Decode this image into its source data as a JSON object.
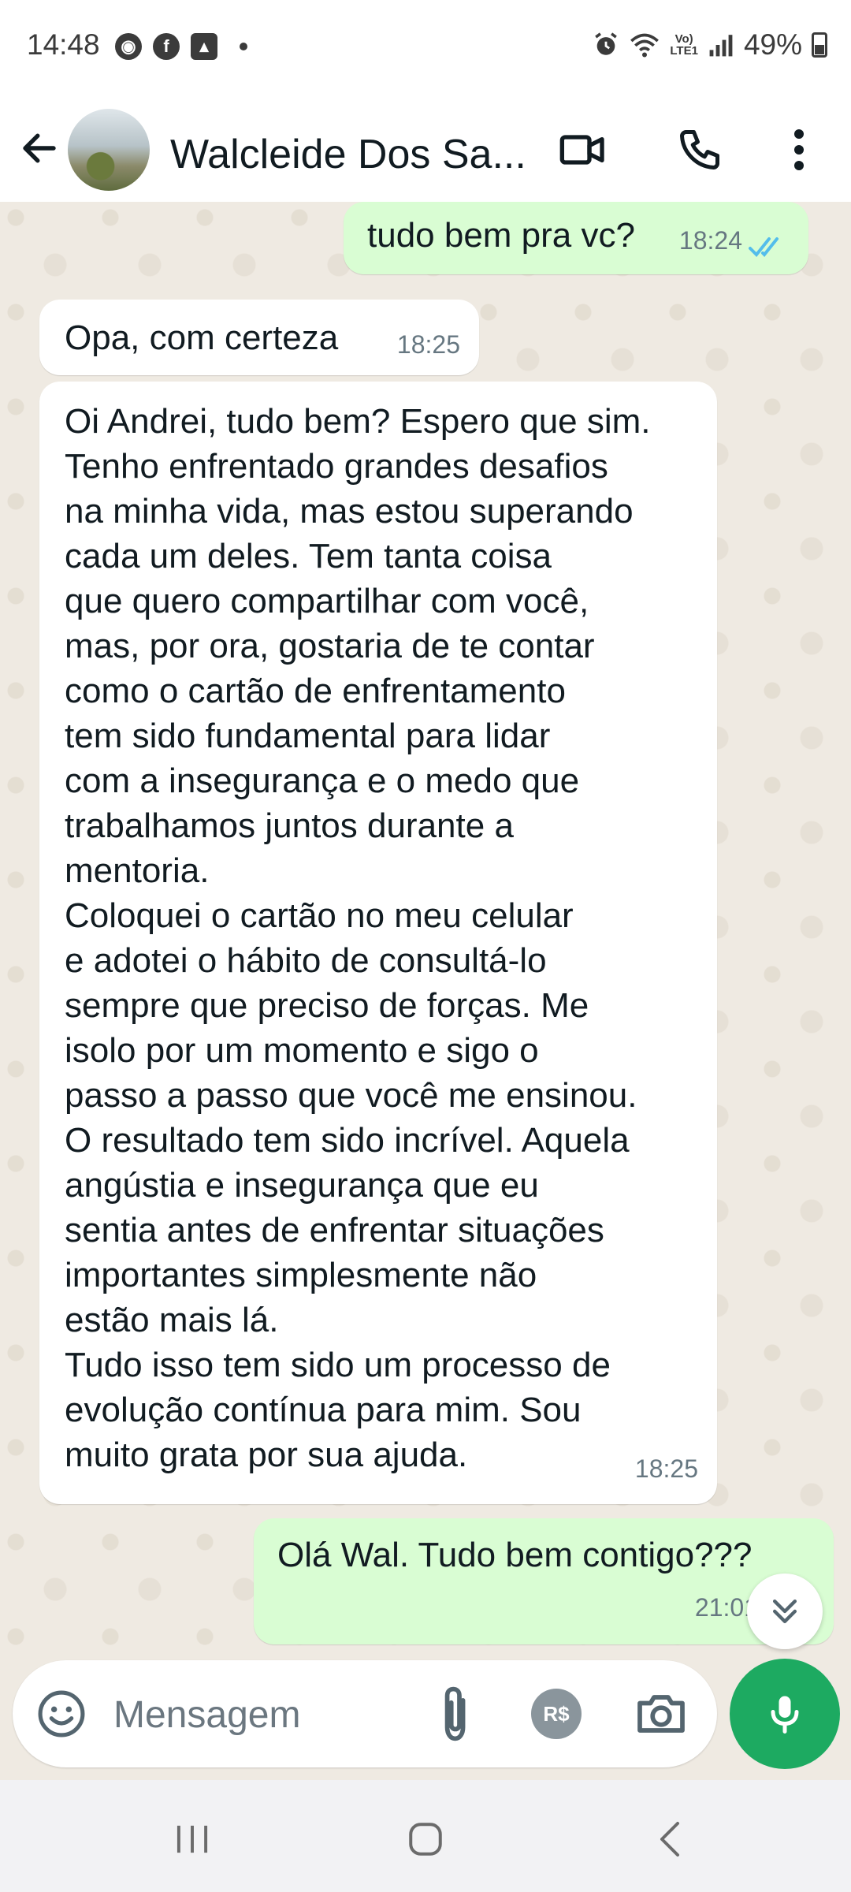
{
  "status_bar": {
    "time": "14:48",
    "network_label_top": "Vo)",
    "network_label_bottom": "LTE1",
    "battery": "49%"
  },
  "header": {
    "contact_name": "Walcleide Dos Sa..."
  },
  "messages": [
    {
      "direction": "out",
      "text": "tudo bem pra vc?",
      "time": "18:24",
      "status": "read"
    },
    {
      "direction": "in",
      "text": "Opa, com certeza",
      "time": "18:25"
    },
    {
      "direction": "in",
      "text": "Oi Andrei, tudo bem? Espero que sim.\nTenho enfrentado grandes desafios\nna minha vida, mas estou superando\ncada um deles. Tem tanta coisa\nque quero compartilhar com você,\nmas, por ora, gostaria de te contar\ncomo o cartão de enfrentamento\ntem sido fundamental para lidar\ncom a insegurança e o medo que\ntrabalhamos juntos durante a\nmentoria.\nColoquei o cartão no meu celular\ne adotei o hábito de consultá-lo\nsempre que preciso de forças. Me\nisolo por um momento e sigo o\npasso a passo que você me ensinou.\nO resultado tem sido incrível. Aquela\nangústia e insegurança que eu\nsentia antes de enfrentar situações\nimportantes simplesmente não\nestão mais lá.\nTudo isso tem sido um processo de\nevolução contínua para mim. Sou\nmuito grata por sua ajuda.",
      "time": "18:25"
    },
    {
      "direction": "out",
      "text": "Olá Wal. Tudo bem contigo???",
      "time": "21:01",
      "status": "read"
    }
  ],
  "composer": {
    "placeholder": "Mensagem",
    "pay_label": "R$"
  },
  "colors": {
    "outgoing_bubble": "#d9fdd3",
    "incoming_bubble": "#ffffff",
    "chat_background": "#efeae2",
    "accent_green": "#1daa61",
    "read_ticks": "#53bdeb"
  },
  "icons": [
    "back-arrow-icon",
    "video-call-icon",
    "phone-icon",
    "more-options-icon",
    "double-check-icon",
    "chevron-double-down-icon",
    "emoji-icon",
    "paperclip-icon",
    "camera-icon",
    "microphone-icon",
    "recent-apps-icon",
    "home-icon",
    "nav-back-icon"
  ]
}
